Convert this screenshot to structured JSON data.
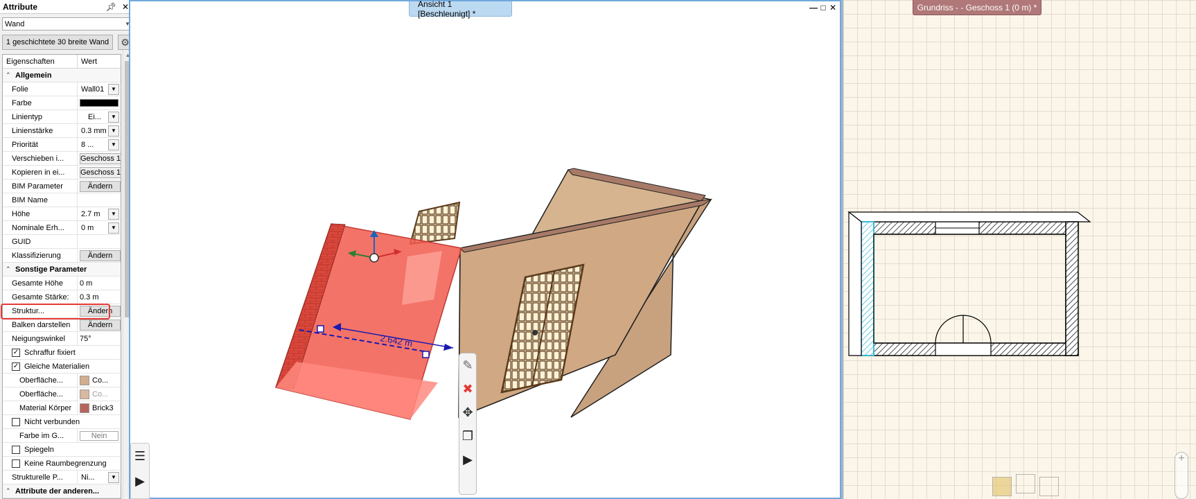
{
  "attributes_panel": {
    "title": "Attribute",
    "pin_icon": "pin-icon",
    "close_icon": "close-icon",
    "element_type": "Wand",
    "wall_type_button": "1 geschichtete 30 breite Wand",
    "settings_icon": "gear-icon",
    "grid_header": {
      "name": "Eigenschaften",
      "value": "Wert"
    },
    "groups": {
      "general": "Allgemein",
      "other": "Sonstige Parameter",
      "attributes_other": "Attribute der anderen..."
    },
    "rows": {
      "folie": {
        "name": "Folie",
        "value": "Wall01"
      },
      "farbe": {
        "name": "Farbe",
        "swatch_color": "#000000"
      },
      "linientyp": {
        "name": "Linientyp",
        "value": "Ei..."
      },
      "linienstaerke": {
        "name": "Linienstärke",
        "value": "0.3 mm"
      },
      "prioritaet": {
        "name": "Priorität",
        "value": "8 ..."
      },
      "verschieben": {
        "name": "Verschieben i...",
        "value": "Geschoss 1"
      },
      "kopieren": {
        "name": "Kopieren in ei...",
        "value": "Geschoss 1"
      },
      "bim_parameter": {
        "name": "BIM Parameter",
        "value": "Ändern"
      },
      "bim_name": {
        "name": "BIM Name",
        "value": ""
      },
      "hoehe": {
        "name": "Höhe",
        "value": "2.7 m"
      },
      "nominale": {
        "name": "Nominale Erh...",
        "value": "0 m"
      },
      "guid": {
        "name": "GUID",
        "value": ""
      },
      "klassifizierung": {
        "name": "Klassifizierung",
        "value": "Ändern"
      },
      "gesamte_hoehe": {
        "name": "Gesamte Höhe",
        "value": "0 m"
      },
      "gesamte_staerke": {
        "name": "Gesamte Stärke:",
        "value": "0.3 m"
      },
      "struktur": {
        "name": "Struktur...",
        "value": "Ändern"
      },
      "balken": {
        "name": "Balken darstellen",
        "value": "Ändern"
      },
      "neigungswinkel": {
        "name": "Neigungswinkel",
        "value": "75°"
      },
      "schraffur": {
        "name": "Schraffur fixiert",
        "checked": true
      },
      "gleiche_materialien": {
        "name": "Gleiche Materialien",
        "checked": true
      },
      "oberflaeche1": {
        "name": "Oberfläche...",
        "value": "Co...",
        "chip_color": "#d2ad8e"
      },
      "oberflaeche2": {
        "name": "Oberfläche...",
        "value": "Co...",
        "chip_color": "#d9b8a0"
      },
      "material_koerper": {
        "name": "Material Körper",
        "value": "Brick3",
        "chip_color": "#b5655b"
      },
      "nicht_verbunden": {
        "name": "Nicht verbunden",
        "checked": false
      },
      "farbe_im_g": {
        "name": "Farbe im G...",
        "value": "Nein"
      },
      "spiegeln": {
        "name": "Spiegeln",
        "checked": false
      },
      "keine_raumbegrenzung": {
        "name": "Keine Raumbegrenzung",
        "checked": false
      },
      "strukturelle": {
        "name": "Strukturelle P...",
        "value": "Ni..."
      }
    }
  },
  "view3d": {
    "tab_title": "Ansicht 1 [Beschleunigt] *",
    "dimension_label": "2.642 m",
    "window_controls": [
      "minimize-icon",
      "maximize-icon",
      "close-icon"
    ],
    "context_toolbar": [
      "pencil-icon",
      "delete-icon",
      "move-icon",
      "copy-icon",
      "expand-icon"
    ],
    "left_dock": [
      "list-icon",
      "play-icon"
    ]
  },
  "floor_plan": {
    "tab_title": "Grundriss -  - Geschoss 1 (0 m) *",
    "view_cube_icons": [
      "cube-top-icon",
      "cube-iso-icon",
      "house-icon"
    ],
    "zoom_icon": "zoom-in-icon"
  }
}
